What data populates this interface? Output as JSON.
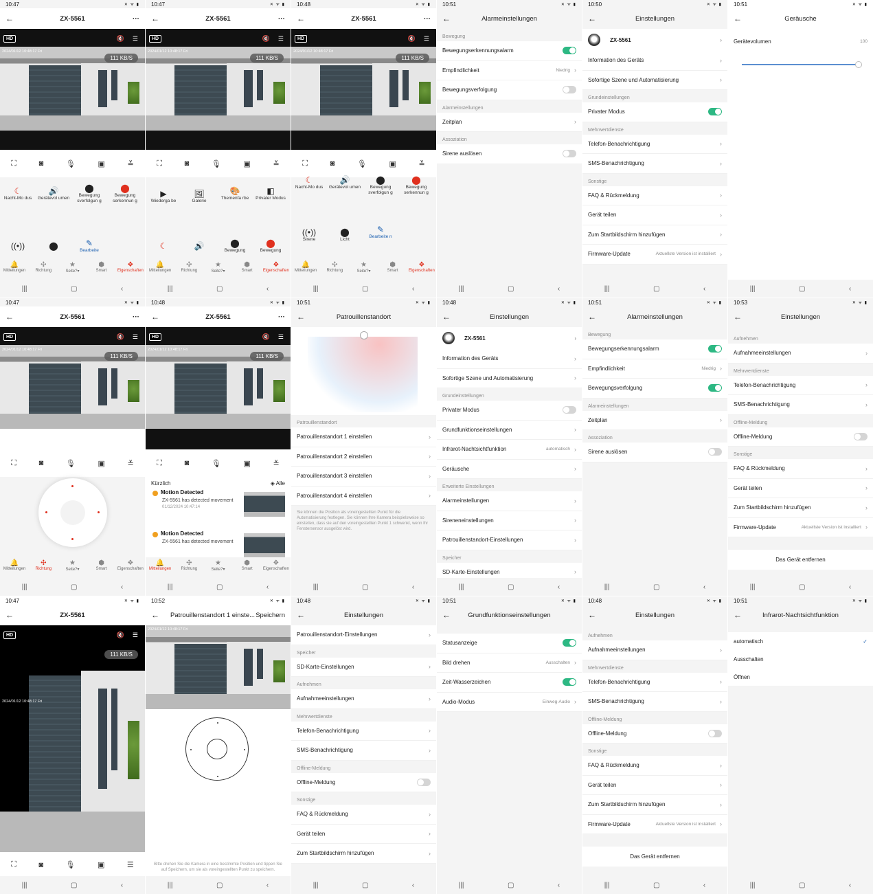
{
  "common": {
    "device": "ZX-5561",
    "hd": "HD",
    "rate": "111 KB/S",
    "timestamp": "2024/01/12 10:48:17 Fri",
    "back": "←",
    "more": "···",
    "chevron": "›",
    "nav": [
      "|||",
      "▢",
      "‹"
    ]
  },
  "tabs": [
    "Mitteilungen",
    "Richtung",
    "Seite?▾",
    "Smart",
    "Eigenschaften"
  ],
  "status_times": [
    "10:47",
    "10:47",
    "10:48",
    "10:51",
    "10:50",
    "10:51",
    "10:47",
    "10:48",
    "10:51",
    "10:48",
    "10:51",
    "10:53",
    "10:47",
    "10:52",
    "10:48",
    "10:51",
    "10:48",
    "10:51"
  ],
  "p1": {
    "features": [
      "Nacht-Mo dus",
      "Gerätevol umen",
      "Bewegung sverfolgun g",
      "Bewegung serkennun g",
      "",
      "",
      "Bearbeite",
      ""
    ]
  },
  "p2": {
    "features": [
      "Wiederga be",
      "Galerie",
      "Themenfa rbe",
      "Privater Modus",
      "",
      "",
      "Bewegung",
      "Bewegung"
    ]
  },
  "p3": {
    "features": [
      "Nacht-Mo dus",
      "Gerätevol umen",
      "Bewegung sverfolgun g",
      "Bewegung serkennun g",
      "Sirene",
      "Licht",
      "Bearbeite n"
    ]
  },
  "alarm": {
    "title": "Alarmeinstellungen",
    "sec_bewegung": "Bewegung",
    "motion_alarm": "Bewegungserkennungsalarm",
    "sensitivity": "Empfindlichkeit",
    "sensitivity_value": "Niedrig",
    "tracking": "Bewegungsverfolgung",
    "sec_alarm": "Alarmeinstellungen",
    "schedule": "Zeitplan",
    "sec_assoc": "Assoziation",
    "siren": "Sirene auslösen"
  },
  "settings": {
    "title": "Einstellungen",
    "info": "Information des Geräts",
    "scene": "Sofortige Szene und Automatisierung",
    "sec_basic": "Grundeinstellungen",
    "private": "Privater Modus",
    "sec_value": "Mehrwertdienste",
    "phone": "Telefon-Benachrichtigung",
    "sms": "SMS-Benachrichtigung",
    "sec_other": "Sonstige",
    "faq": "FAQ & Rückmeldung",
    "share": "Gerät teilen",
    "home": "Zum Startbildschirm hinzufügen",
    "firmware": "Firmware-Update",
    "firmware_value": "Aktuellste Version ist installiert",
    "basic_func": "Grundfunktionseinstellungen",
    "ir": "Infrarot-Nachtsichtfunktion",
    "ir_value": "automatisch",
    "sounds": "Geräusche",
    "sec_advanced": "Erweiterte Einstellungen",
    "alarm": "Alarmeinstellungen",
    "siren_settings": "Sireneneinstellungen",
    "patrol_settings": "Patrouillenstandort-Einstellungen",
    "sec_storage": "Speicher",
    "sd": "SD-Karte-Einstellungen",
    "sec_record": "Aufnehmen",
    "record": "Aufnahmeeinstellungen",
    "sec_offline": "Offline-Meldung",
    "offline": "Offline-Meldung",
    "remove": "Das Gerät entfernen",
    "partial_top": "Patrouillenstandort-Einstellungen"
  },
  "sounds": {
    "title": "Geräusche",
    "volume": "Gerätevolumen",
    "volume_value": "100"
  },
  "messages": {
    "recent": "Kürzlich",
    "all": "Alle",
    "items": [
      {
        "title": "Motion Detected",
        "desc": "ZX-5561 has detected movement",
        "time": "01/12/2024 10:47:14"
      },
      {
        "title": "Motion Detected",
        "desc": "ZX-5561 has detected movement",
        "time": ""
      }
    ]
  },
  "patrol": {
    "title": "Patrouillenstandort",
    "section": "Patrouillenstandort",
    "items": [
      "Patrouillenstandort 1 einstellen",
      "Patrouillenstandort 2 einstellen",
      "Patrouillenstandort 3 einstellen",
      "Patrouillenstandort 4 einstellen"
    ],
    "note": "Sie können die Position als voreingestellten Punkt für die Automatisierung festlegen. Sie können Ihre Kamera beispielsweise so einstellen, dass sie auf den voreingestellten Punkt 1 schwenkt, wenn Ihr Fenstersensor ausgelöst wird."
  },
  "patrol_set": {
    "title": "Patrouillenstandort 1 einste...",
    "save": "Speichern",
    "hint": "Bitte drehen Sie die Kamera in eine bestimmte Position und tippen Sie auf Speichern, um sie als voreingestellten Punkt zu speichern."
  },
  "basic": {
    "title": "Grundfunktionseinstellungen",
    "status": "Statusanzeige",
    "rotate": "Bild drehen",
    "rotate_value": "Ausschalten",
    "watermark": "Zeit-Wasserzeichen",
    "audio": "Audio-Modus",
    "audio_value": "Einweg-Audio"
  },
  "ir": {
    "title": "Infrarot-Nachtsichtfunktion",
    "options": [
      "automatisch",
      "Ausschalten",
      "Öffnen"
    ],
    "check": "✓"
  },
  "colors": {
    "accent": "#e0301e",
    "toggle_on": "#2db883",
    "link": "#1b5fb0"
  }
}
